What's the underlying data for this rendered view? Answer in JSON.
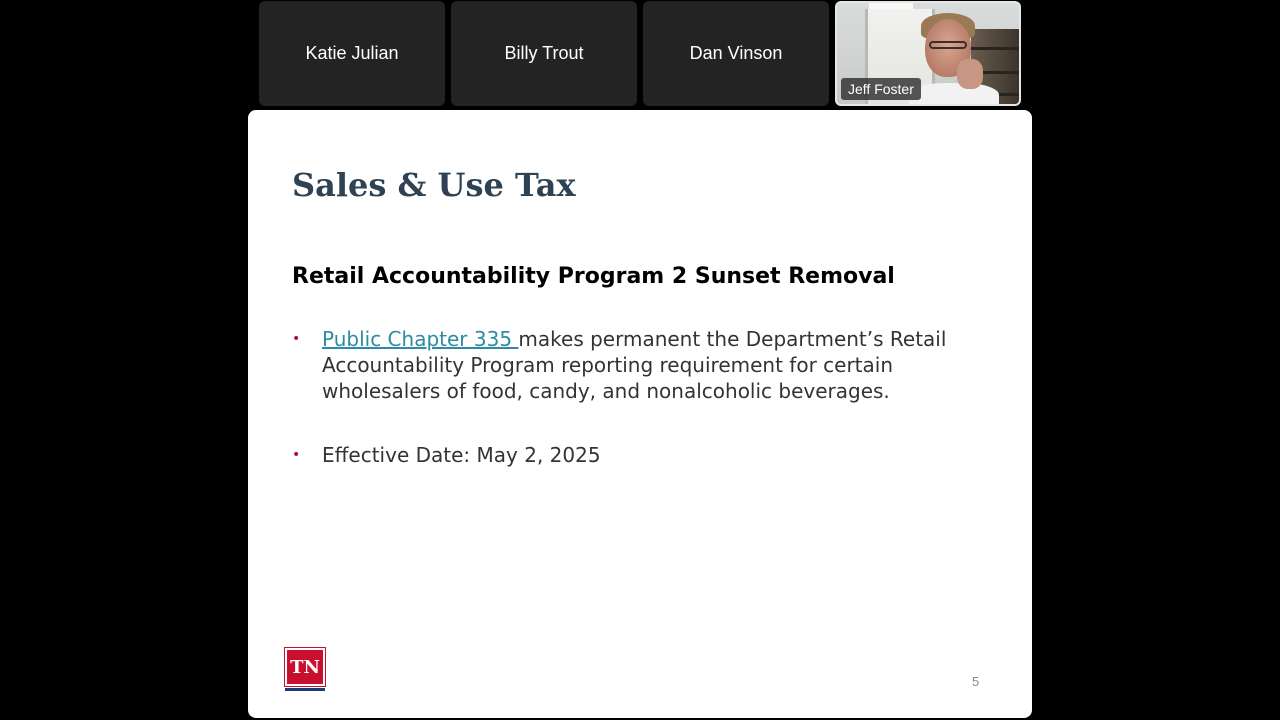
{
  "participants": [
    {
      "name": "Katie Julian"
    },
    {
      "name": "Billy Trout"
    },
    {
      "name": "Dan Vinson"
    },
    {
      "name": "Jeff Foster",
      "has_video": true
    }
  ],
  "slide": {
    "title": "Sales & Use Tax",
    "subtitle": "Retail Accountability Program 2 Sunset Removal",
    "bullets": [
      {
        "link_text": "Public Chapter 335 ",
        "text": "makes permanent the Department’s Retail Accountability Program reporting requirement for certain wholesalers of food, candy, and nonalcoholic beverages."
      },
      {
        "text": "Effective Date: May 2, 2025"
      }
    ],
    "logo_text": "TN",
    "page_number": "5",
    "colors": {
      "title": "#2e4253",
      "bullet": "#b0102c",
      "link": "#2b8ca3",
      "logo": "#c8102e"
    }
  }
}
